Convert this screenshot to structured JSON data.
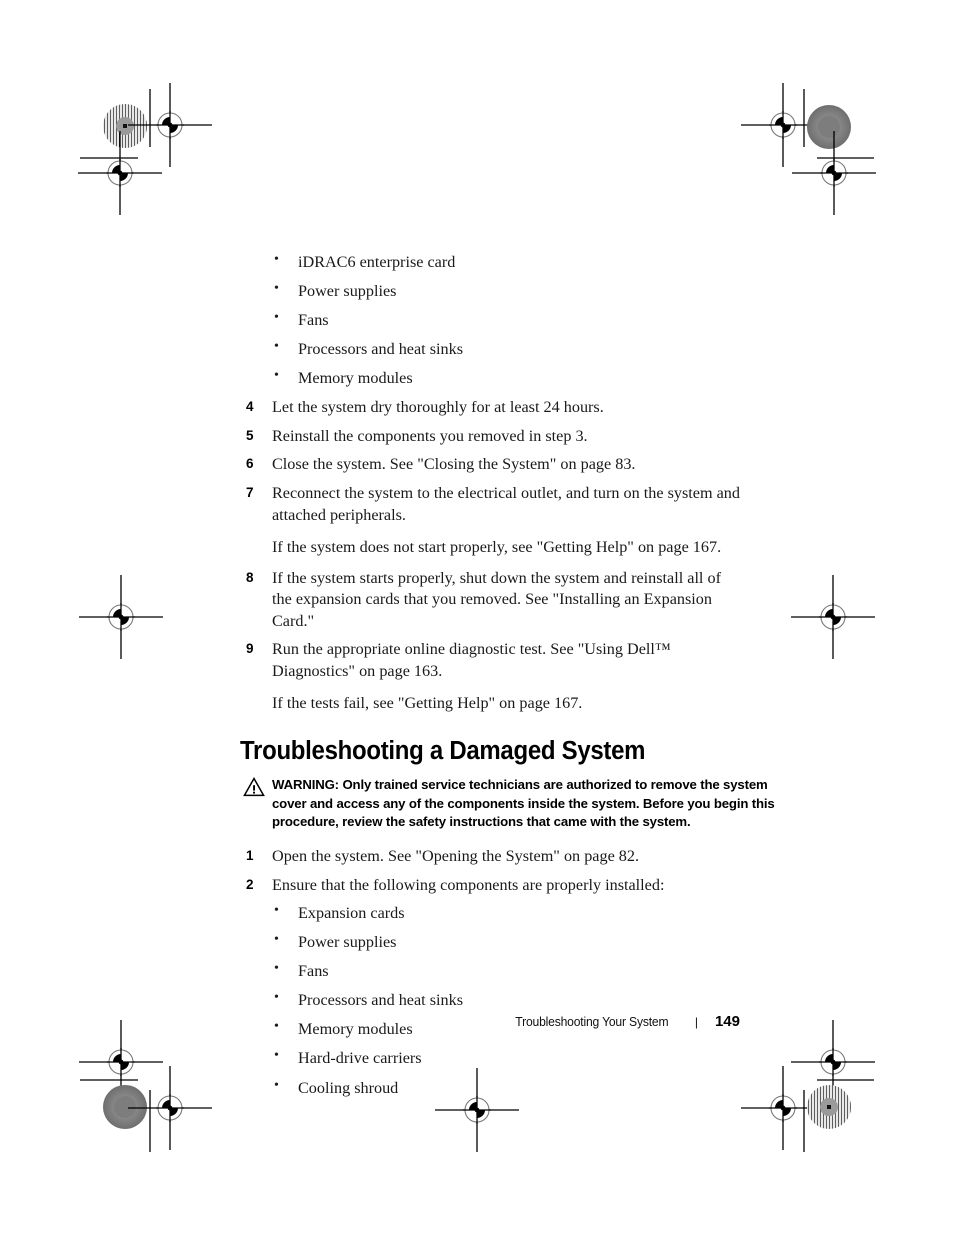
{
  "document": {
    "page_number": "149",
    "footer_title": "Troubleshooting Your System",
    "footer_separator": "|"
  },
  "content": {
    "top_bullets": [
      "iDRAC6 enterprise card",
      "Power supplies",
      "Fans",
      "Processors and heat sinks",
      "Memory modules"
    ],
    "steps": [
      {
        "num": "4",
        "text": "Let the system dry thoroughly for at least 24 hours."
      },
      {
        "num": "5",
        "text": "Reinstall the components you removed in step 3."
      },
      {
        "num": "6",
        "text": "Close the system. See \"Closing the System\" on page 83."
      },
      {
        "num": "7",
        "text": "Reconnect the system to the electrical outlet, and turn on the system and attached peripherals."
      }
    ],
    "note_after_7": "If the system does not start properly, see \"Getting Help\" on page 167.",
    "step_8": {
      "num": "8",
      "text": "If the system starts properly, shut down the system and reinstall all of the expansion cards that you removed. See \"Installing an Expansion Card.\""
    },
    "step_9": {
      "num": "9",
      "text": "Run the appropriate online diagnostic test. See \"Using Dell™ Diagnostics\" on page 163."
    },
    "note_after_9": "If the tests fail, see \"Getting Help\" on page 167."
  },
  "section": {
    "heading": "Troubleshooting a Damaged System",
    "warning_label": "WARNING:",
    "warning_text": " Only trained service technicians are authorized to remove the system cover and access any of the components inside the system. Before you begin this procedure, review the safety instructions that came with the system.",
    "warning_icon": "warning-triangle-icon",
    "steps": [
      {
        "num": "1",
        "text": "Open the system. See \"Opening the System\" on page 82."
      },
      {
        "num": "2",
        "text": "Ensure that the following components are properly installed:"
      }
    ],
    "bottom_bullets": [
      "Expansion cards",
      "Power supplies",
      "Fans",
      "Processors and heat sinks",
      "Memory modules",
      "Hard-drive carriers",
      "Cooling shroud"
    ]
  },
  "print_marks": {
    "registration_mark": "registration-crosshair-icon",
    "color_target": "color-density-target-icon",
    "trim_line": "trim-line"
  }
}
